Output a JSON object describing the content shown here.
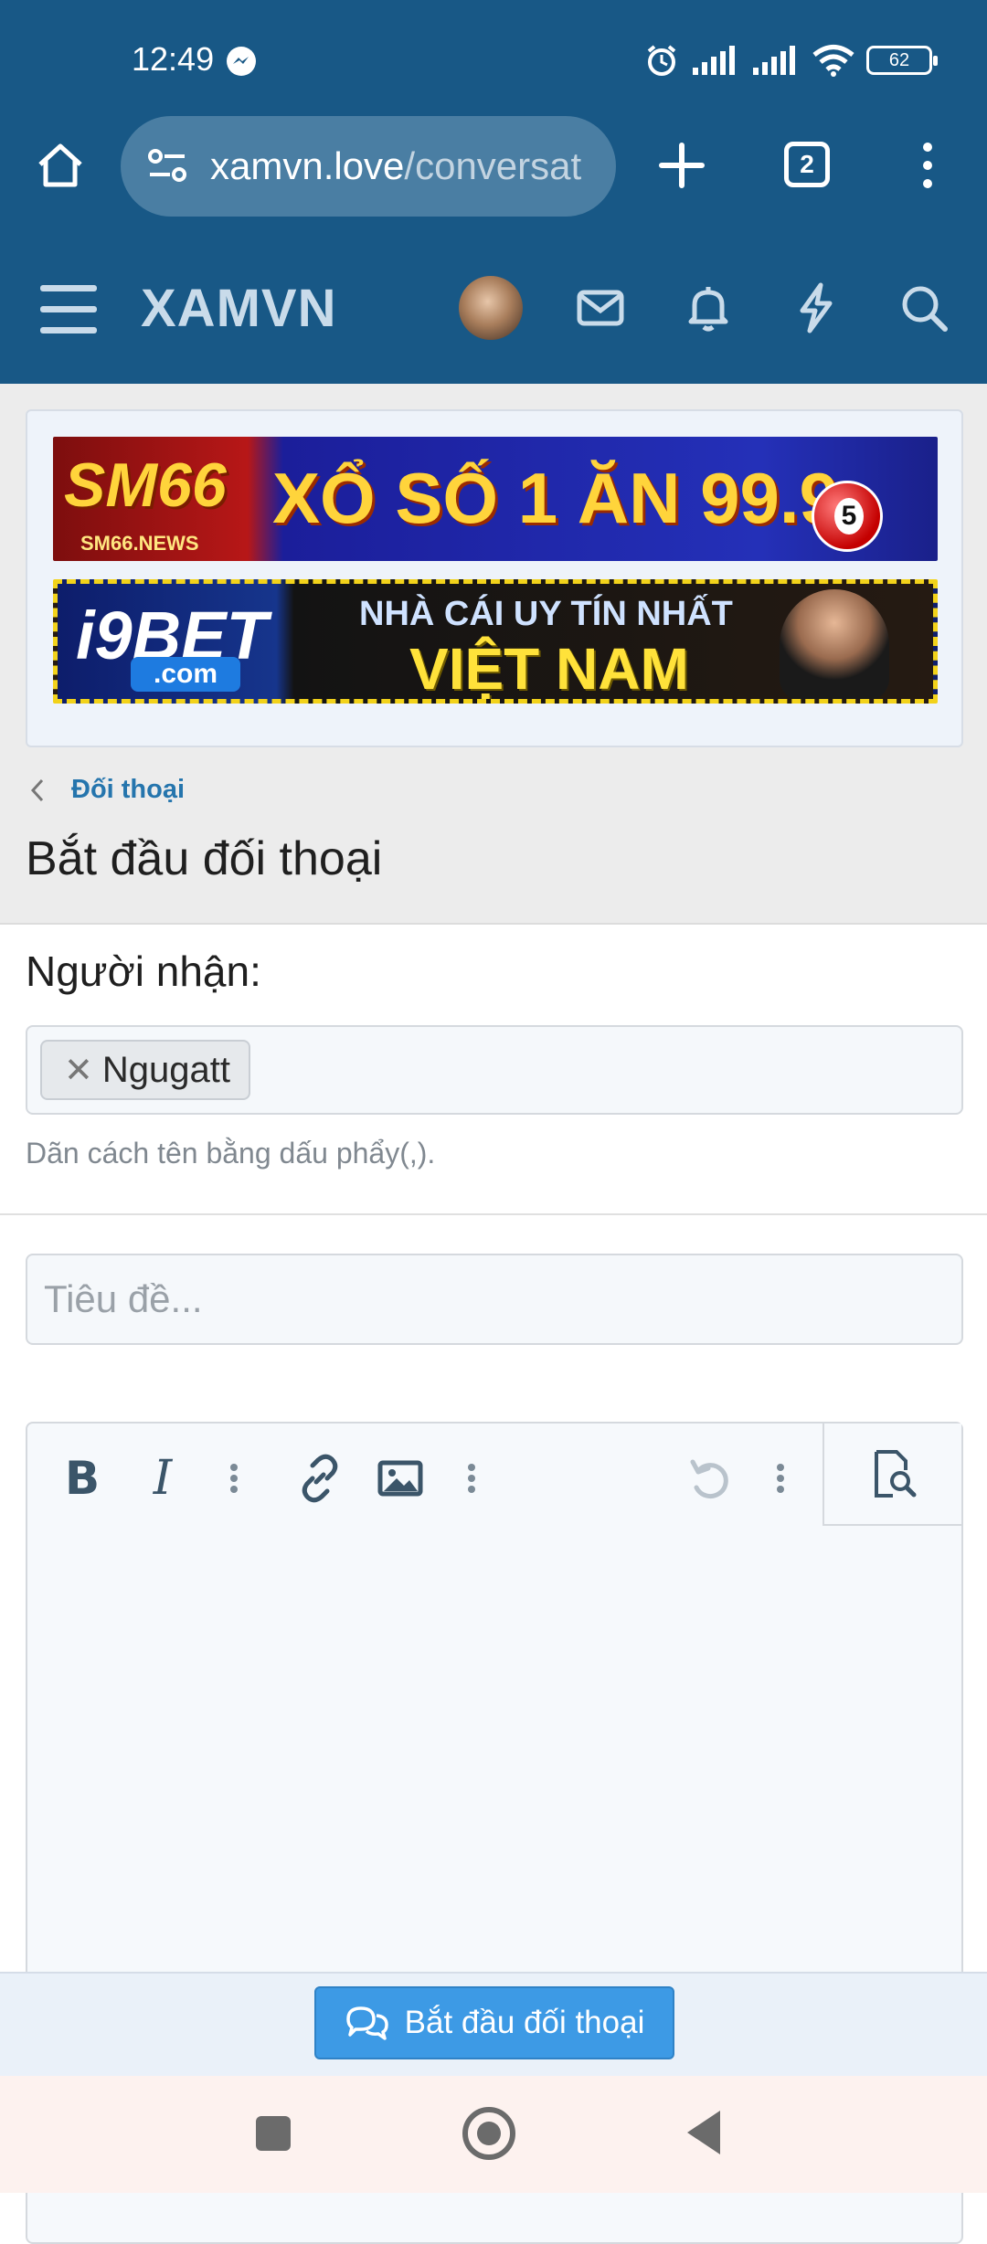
{
  "status_bar": {
    "time": "12:49",
    "battery": "62"
  },
  "browser": {
    "url_host": "xamvn.love",
    "url_path": "/conversat",
    "tab_count": "2"
  },
  "site": {
    "logo": "XAMVN"
  },
  "ads": {
    "banner1": {
      "brand": "SM66",
      "sub": "SM66.NEWS",
      "headline": "XỔ SỐ 1 ĂN 99.9",
      "ball": "5"
    },
    "banner2": {
      "brand": "i9BET",
      "domain": ".com",
      "line1": "NHÀ CÁI UY TÍN NHẤT",
      "line2": "VIỆT NAM"
    }
  },
  "breadcrumb": {
    "label": "Đối thoại"
  },
  "page": {
    "title": "Bắt đầu đối thoại"
  },
  "form": {
    "recipient_label": "Người nhận:",
    "recipients": [
      "Ngugatt"
    ],
    "recipient_remove_glyph": "✕",
    "hint": "Dãn cách tên bằng dấu phẩy(,).",
    "title_placeholder": "Tiêu đề..."
  },
  "editor": {
    "tools": [
      "bold-icon",
      "italic-icon",
      "more-icon",
      "link-icon",
      "image-icon",
      "more-icon",
      "undo-icon",
      "more-icon",
      "preview-icon"
    ],
    "bold_glyph": "B",
    "italic_glyph": "I"
  },
  "submit": {
    "label": "Bắt đầu đối thoại"
  },
  "colors": {
    "header": "#185886",
    "accent": "#3d9ae5",
    "link": "#2575ad"
  }
}
